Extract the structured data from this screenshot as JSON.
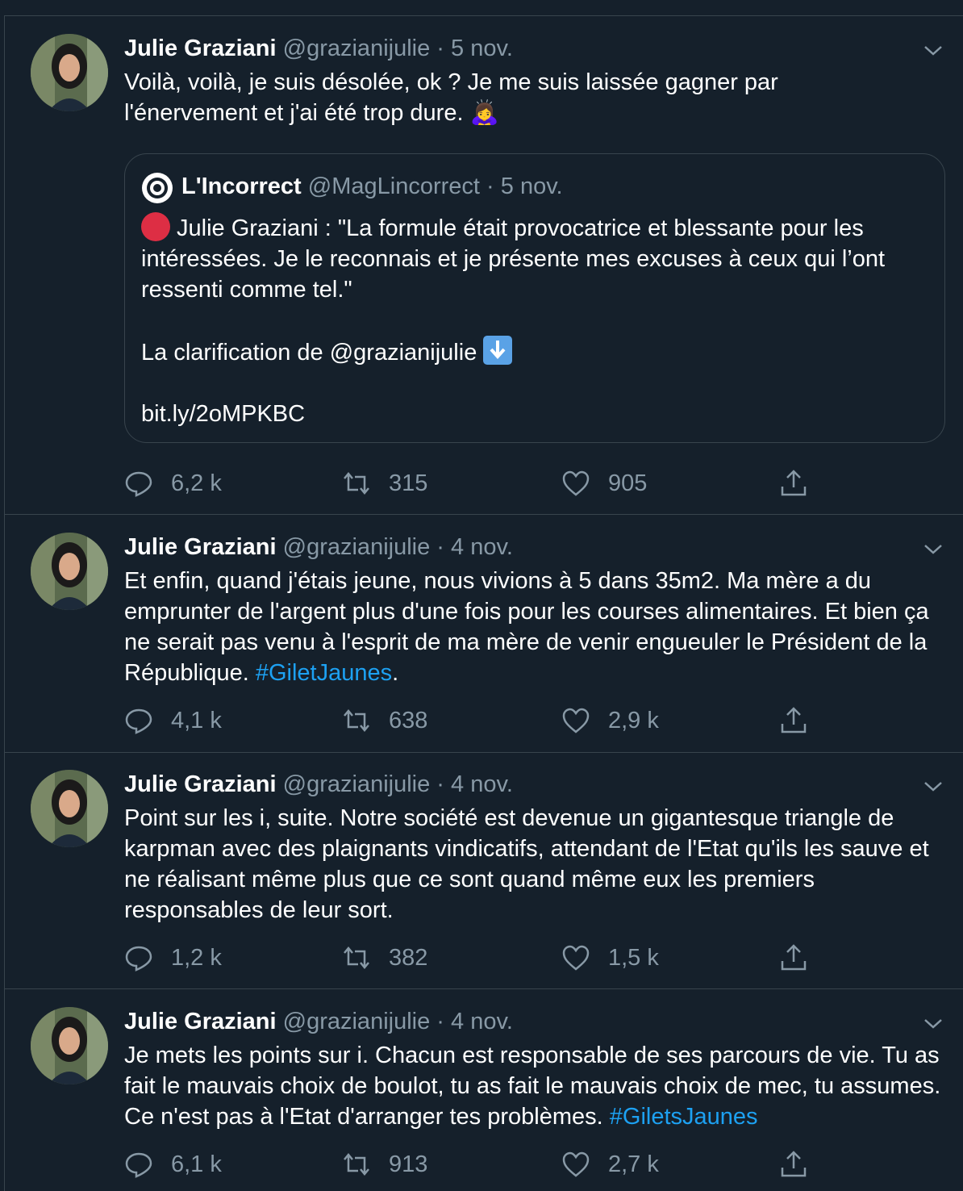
{
  "tweets": [
    {
      "author": "Julie Graziani",
      "handle": "@grazianijulie",
      "separator": "·",
      "date": "5 nov.",
      "text_lines": [
        "Voilà, voilà, je suis désolée, ok ? Je me suis laissée gagner par",
        "l'énervement et j'ai été trop dure. 🙇‍♀️"
      ],
      "quote": {
        "author": "L'Incorrect",
        "handle": "@MagLincorrect",
        "separator": "·",
        "date": "5 nov.",
        "text_part1": "Julie Graziani : \"La formule était provocatrice et blessante pour les intéressées. Je le reconnais et je présente mes excuses à ceux qui l’ont ressenti comme tel.\"",
        "text_part2": "La clarification de @grazianijulie",
        "text_part3": "bit.ly/2oMPKBC"
      },
      "replies": "6,2 k",
      "retweets": "315",
      "likes": "905"
    },
    {
      "author": "Julie Graziani",
      "handle": "@grazianijulie",
      "separator": "·",
      "date": "4 nov.",
      "text": "Et enfin, quand j'étais jeune, nous vivions à 5 dans 35m2. Ma mère a du emprunter de l'argent plus d'une fois pour les courses alimentaires. Et bien ça ne serait pas venu à l'esprit de ma mère de venir engueuler le Président de la République.",
      "hashtag": "#GiletJaunes",
      "text_after": ".",
      "replies": "4,1 k",
      "retweets": "638",
      "likes": "2,9 k"
    },
    {
      "author": "Julie Graziani",
      "handle": "@grazianijulie",
      "separator": "·",
      "date": "4 nov.",
      "text": "Point sur les i, suite. Notre société est devenue un gigantesque triangle de karpman avec des plaignants vindicatifs, attendant de l'Etat qu'ils les sauve et ne réalisant même plus que ce sont quand même eux les premiers responsables de leur sort.",
      "replies": "1,2 k",
      "retweets": "382",
      "likes": "1,5 k"
    },
    {
      "author": "Julie Graziani",
      "handle": "@grazianijulie",
      "separator": "·",
      "date": "4 nov.",
      "text": "Je mets les points sur i. Chacun est responsable de ses parcours de vie. Tu as fait le mauvais choix de boulot, tu as fait le mauvais choix de mec, tu assumes. Ce n'est pas à l'Etat d'arranger tes problèmes.",
      "hashtag": "#GiletsJaunes",
      "replies": "6,1 k",
      "retweets": "913",
      "likes": "2,7 k"
    }
  ],
  "colors": {
    "background": "#15202b",
    "border": "#38444d",
    "secondary_text": "#8899a6",
    "link": "#1da1f2"
  },
  "icons": [
    "avatar",
    "chevron-down-icon",
    "reply-icon",
    "retweet-icon",
    "like-icon",
    "share-icon",
    "incorrect-logo-icon"
  ]
}
